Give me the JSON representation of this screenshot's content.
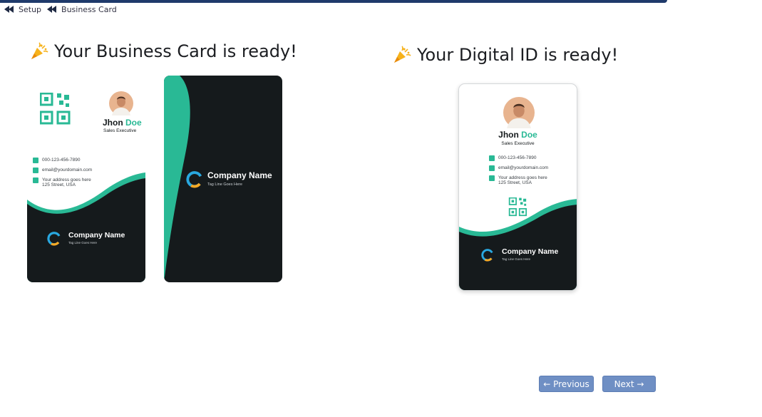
{
  "breadcrumb": {
    "items": [
      "Setup",
      "Business Card"
    ]
  },
  "business_card": {
    "title": "Your Business Card is ready!",
    "front": {
      "first_name": "Jhon",
      "last_name": "Doe",
      "role": "Sales Executive",
      "phone": "000-123-456-7890",
      "email": "email@yourdomain.com",
      "address_line1": "Your address goes here",
      "address_line2": "125 Street, USA",
      "company": "Company Name",
      "tagline": "Tag Line Goes Here"
    },
    "back": {
      "company": "Company Name",
      "tagline": "Tag Line Goes Here"
    }
  },
  "digital_id": {
    "title": "Your Digital ID is ready!",
    "first_name": "Jhon",
    "last_name": "Doe",
    "role": "Sales Executive",
    "phone": "000-123-456-7890",
    "email": "email@yourdomain.com",
    "address_line1": "Your address goes here",
    "address_line2": "125 Street, USA",
    "company": "Company Name",
    "tagline": "Tag Line Goes Here"
  },
  "nav": {
    "previous_label": "← Previous",
    "next_label": "Next →"
  },
  "colors": {
    "accent": "#29b995",
    "dark": "#151a1c",
    "button": "#6f8fc4",
    "header": "#1f3a6b"
  },
  "icons": [
    "rewind-icon",
    "party-popper-icon",
    "qr-code-icon",
    "phone-icon",
    "email-icon",
    "location-icon",
    "company-logo-icon",
    "avatar"
  ]
}
